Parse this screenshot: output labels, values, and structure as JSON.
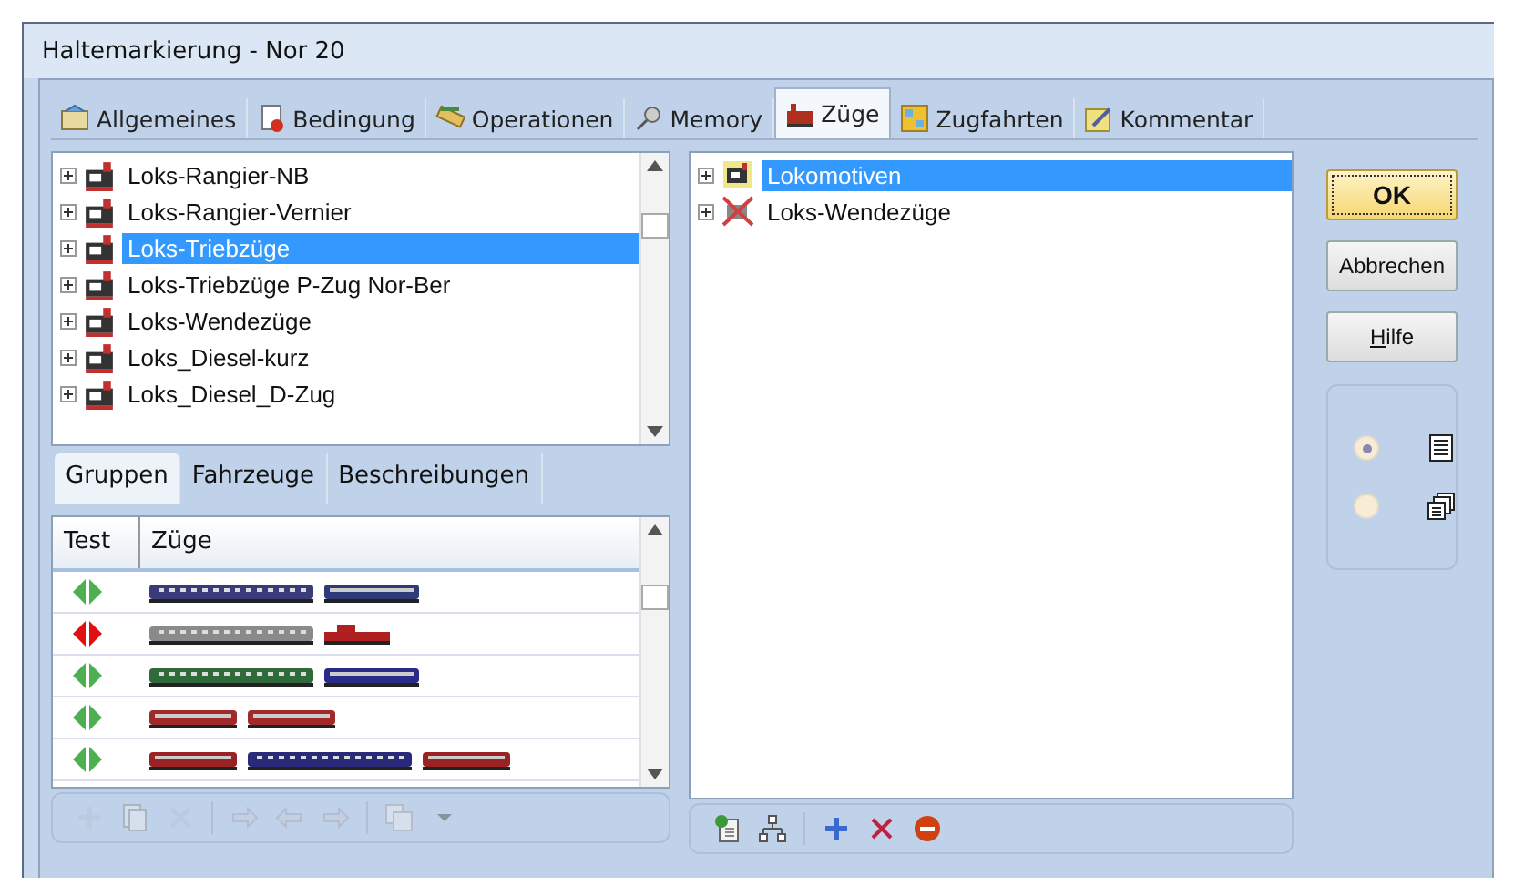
{
  "window": {
    "title": "Haltemarkierung - Nor 20"
  },
  "tabs": [
    {
      "label": "Allgemeines",
      "selected": false
    },
    {
      "label": "Bedingung",
      "selected": false
    },
    {
      "label": "Operationen",
      "selected": false
    },
    {
      "label": "Memory",
      "selected": false
    },
    {
      "label": "Züge",
      "selected": true
    },
    {
      "label": "Zugfahrten",
      "selected": false
    },
    {
      "label": "Kommentar",
      "selected": false
    }
  ],
  "group_tree": {
    "items": [
      {
        "label": "Loks-Rangier-NB",
        "selected": false
      },
      {
        "label": "Loks-Rangier-Vernier",
        "selected": false
      },
      {
        "label": "Loks-Triebzüge",
        "selected": true
      },
      {
        "label": "Loks-Triebzüge P-Zug Nor-Ber",
        "selected": false
      },
      {
        "label": "Loks-Wendezüge",
        "selected": false
      },
      {
        "label": "Loks_Diesel-kurz",
        "selected": false
      },
      {
        "label": "Loks_Diesel_D-Zug",
        "selected": false
      }
    ]
  },
  "sub_tabs": [
    {
      "label": "Gruppen",
      "selected": true
    },
    {
      "label": "Fahrzeuge",
      "selected": false
    },
    {
      "label": "Beschreibungen",
      "selected": false
    }
  ],
  "table": {
    "columns": [
      "Test",
      "Züge"
    ],
    "rows": [
      {
        "color": "#4caf50",
        "vehicles": [
          {
            "kind": "coach",
            "color": "#3b3a7a"
          },
          {
            "kind": "loco",
            "color": "#2f3a7a"
          }
        ]
      },
      {
        "color": "#e01010",
        "vehicles": [
          {
            "kind": "coach",
            "color": "#8a8a8a"
          },
          {
            "kind": "shunter",
            "color": "#b02020"
          }
        ]
      },
      {
        "color": "#4caf50",
        "vehicles": [
          {
            "kind": "coach",
            "color": "#2f6a3a"
          },
          {
            "kind": "loco",
            "color": "#2a2a8a"
          }
        ]
      },
      {
        "color": "#4caf50",
        "vehicles": [
          {
            "kind": "railcar",
            "color": "#a02a2a"
          },
          {
            "kind": "railcar",
            "color": "#a02a2a"
          }
        ]
      },
      {
        "color": "#4caf50",
        "vehicles": [
          {
            "kind": "railcar",
            "color": "#9a2222"
          },
          {
            "kind": "coach",
            "color": "#2a2a7a"
          },
          {
            "kind": "railcar",
            "color": "#9a2222"
          }
        ]
      }
    ]
  },
  "left_toolbar": [
    {
      "kind": "plus",
      "disabled": true
    },
    {
      "kind": "copy",
      "disabled": true
    },
    {
      "kind": "cross",
      "disabled": true
    },
    {
      "kind": "sep"
    },
    {
      "kind": "right",
      "disabled": true
    },
    {
      "kind": "left",
      "disabled": true
    },
    {
      "kind": "right",
      "disabled": true
    },
    {
      "kind": "sep"
    },
    {
      "kind": "pages",
      "disabled": true
    },
    {
      "kind": "caret",
      "disabled": true
    }
  ],
  "train_tree": {
    "items": [
      {
        "label": "Lokomotiven",
        "kind": "loco",
        "selected": true
      },
      {
        "label": "Loks-Wendezüge",
        "kind": "crossed",
        "selected": false
      }
    ]
  },
  "right_toolbar": [
    {
      "kind": "newdoc",
      "disabled": false
    },
    {
      "kind": "hierarchy",
      "disabled": false
    },
    {
      "kind": "sep"
    },
    {
      "kind": "plus",
      "disabled": false
    },
    {
      "kind": "cross",
      "disabled": false
    },
    {
      "kind": "stop",
      "disabled": false
    }
  ],
  "buttons": [
    {
      "label": "OK",
      "kind": "default"
    },
    {
      "label": "Abbrechen",
      "kind": "normal"
    },
    {
      "label": "Hilfe",
      "kind": "mnemonic"
    }
  ],
  "view_options": [
    {
      "kind": "list",
      "selected": true
    },
    {
      "kind": "stack",
      "selected": false
    }
  ]
}
